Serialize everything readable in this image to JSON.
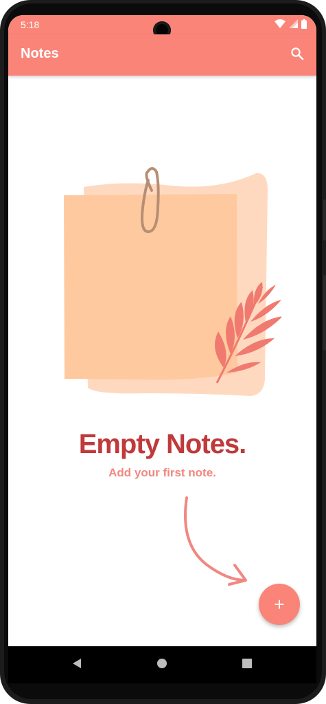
{
  "status_bar": {
    "time": "5:18",
    "icons": [
      "wifi-icon",
      "signal-icon",
      "battery-icon"
    ]
  },
  "app_bar": {
    "title": "Notes",
    "search_icon": "search-icon",
    "color": "#fa8478"
  },
  "empty_state": {
    "title": "Empty Notes.",
    "subtitle": "Add your first note.",
    "title_color": "#c0393b",
    "subtitle_color": "#f08880"
  },
  "fab": {
    "icon": "plus-icon",
    "label": "+"
  },
  "nav_bar": {
    "buttons": [
      "back-icon",
      "home-icon",
      "recents-icon"
    ]
  }
}
